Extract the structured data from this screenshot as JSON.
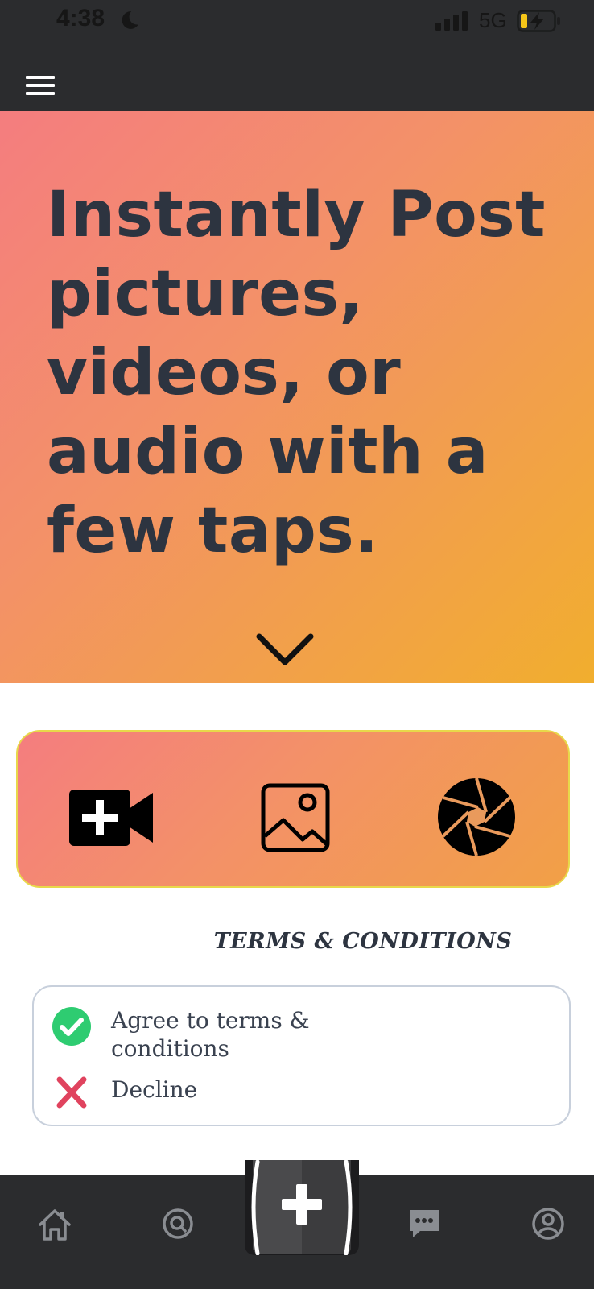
{
  "status_bar": {
    "time": "4:38",
    "network": "5G",
    "icons": [
      "moon-icon",
      "signal-icon",
      "battery-charging-icon"
    ]
  },
  "header": {
    "menu_icon": "hamburger-menu-icon"
  },
  "hero": {
    "title": "Instantly Post pictures, videos, or audio with a few taps.",
    "scroll_icon": "chevron-down-icon",
    "gradient": [
      "#f47d7f",
      "#f1ae2e"
    ]
  },
  "media_actions": [
    {
      "name": "add-video",
      "icon": "video-plus-icon"
    },
    {
      "name": "add-image",
      "icon": "image-icon"
    },
    {
      "name": "camera",
      "icon": "camera-aperture-icon"
    }
  ],
  "terms": {
    "title": "TERMS & CONDITIONS",
    "agree_label": "Agree to terms & conditions",
    "decline_label": "Decline",
    "agree_color": "#2ecc71",
    "decline_color": "#e0435e"
  },
  "bottom_nav": {
    "items": [
      "home-icon",
      "search-icon",
      "add-post-icon",
      "chat-icon",
      "profile-icon"
    ]
  },
  "colors": {
    "dark_bar": "#2b2c2e",
    "text_dark": "#2d3440"
  }
}
